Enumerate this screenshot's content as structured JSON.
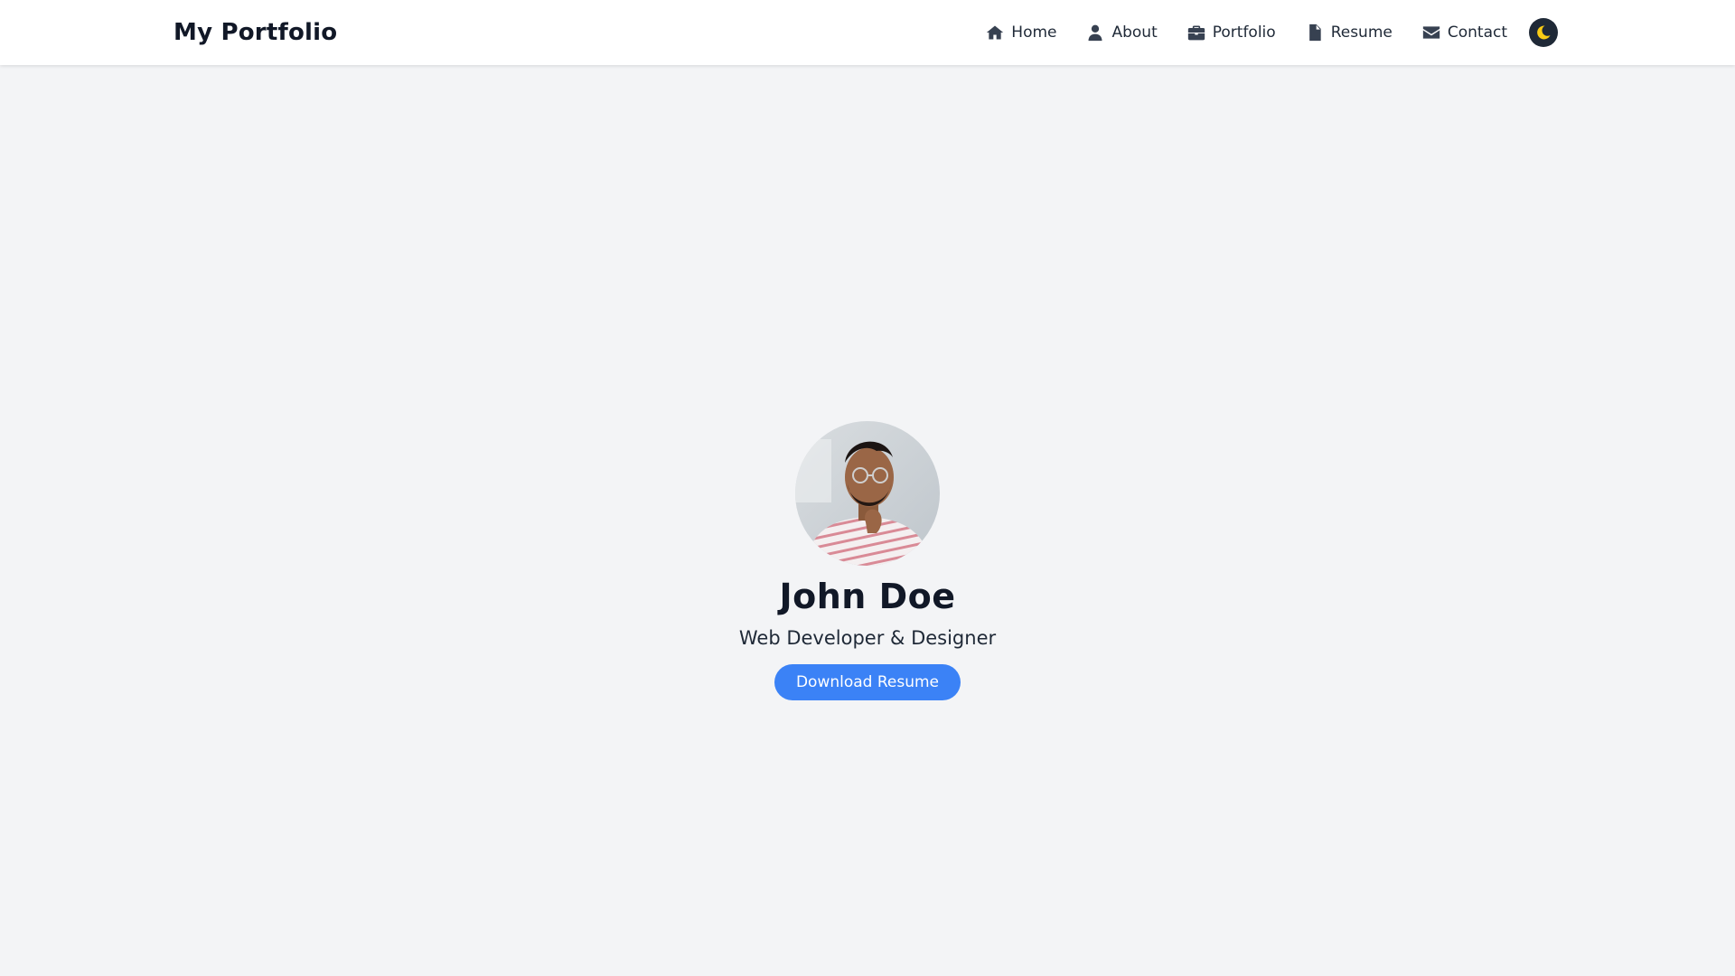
{
  "header": {
    "brand": "My Portfolio",
    "nav": [
      {
        "label": "Home",
        "icon": "home-icon"
      },
      {
        "label": "About",
        "icon": "user-icon"
      },
      {
        "label": "Portfolio",
        "icon": "briefcase-icon"
      },
      {
        "label": "Resume",
        "icon": "document-icon"
      },
      {
        "label": "Contact",
        "icon": "envelope-icon"
      }
    ],
    "theme_toggle_icon": "moon-icon"
  },
  "hero": {
    "name": "John Doe",
    "subtitle": "Web Developer & Designer",
    "button_label": "Download Resume"
  },
  "colors": {
    "accent": "#3b82f6",
    "background": "#f3f4f6",
    "text": "#111827",
    "toggle_bg": "#1f2937",
    "toggle_icon": "#facc15"
  }
}
